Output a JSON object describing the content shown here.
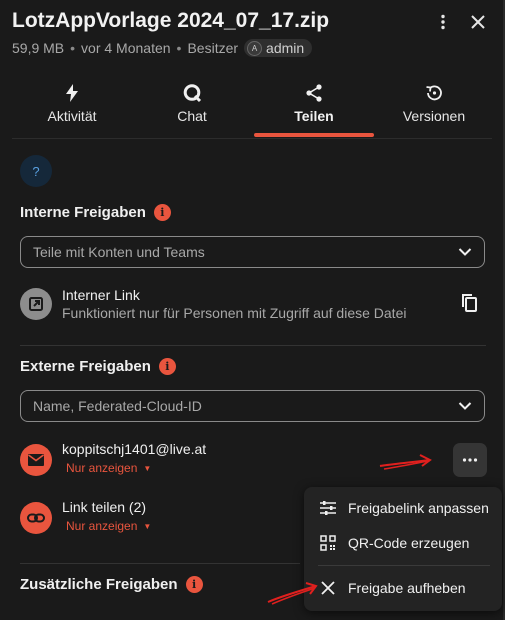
{
  "header": {
    "title": "LotzAppVorlage 2024_07_17.zip",
    "size": "59,9 MB",
    "modified": "vor 4 Monaten",
    "owner_label": "Besitzer",
    "owner_initial": "A",
    "owner_name": "admin"
  },
  "tabs": [
    {
      "label": "Aktivität",
      "icon": "flash-icon"
    },
    {
      "label": "Chat",
      "icon": "chat-icon"
    },
    {
      "label": "Teilen",
      "icon": "share-icon",
      "active": true
    },
    {
      "label": "Versionen",
      "icon": "history-icon"
    }
  ],
  "help": {
    "symbol": "?"
  },
  "internal": {
    "title": "Interne Freigaben",
    "info_symbol": "i",
    "select_placeholder": "Teile mit Konten und Teams",
    "link_title": "Interner Link",
    "link_subtitle": "Funktioniert nur für Personen mit Zugriff auf diese Datei"
  },
  "external": {
    "title": "Externe Freigaben",
    "info_symbol": "i",
    "select_placeholder": "Name, Federated-Cloud-ID",
    "shares": [
      {
        "title": "koppitschj1401@live.at",
        "permission": "Nur anzeigen",
        "icon": "mail-icon"
      },
      {
        "title": "Link teilen (2)",
        "permission": "Nur anzeigen",
        "icon": "link-icon"
      }
    ]
  },
  "additional": {
    "title": "Zusätzliche Freigaben",
    "info_symbol": "i"
  },
  "menu": {
    "items": [
      {
        "label": "Freigabelink anpassen",
        "icon": "tune-icon"
      },
      {
        "label": "QR-Code erzeugen",
        "icon": "qr-code-icon"
      },
      {
        "label": "Freigabe aufheben",
        "icon": "close-icon"
      }
    ]
  },
  "colors": {
    "accent": "#e9553e",
    "background": "#1a1a1a",
    "annotation_arrow": "#e0201e"
  }
}
